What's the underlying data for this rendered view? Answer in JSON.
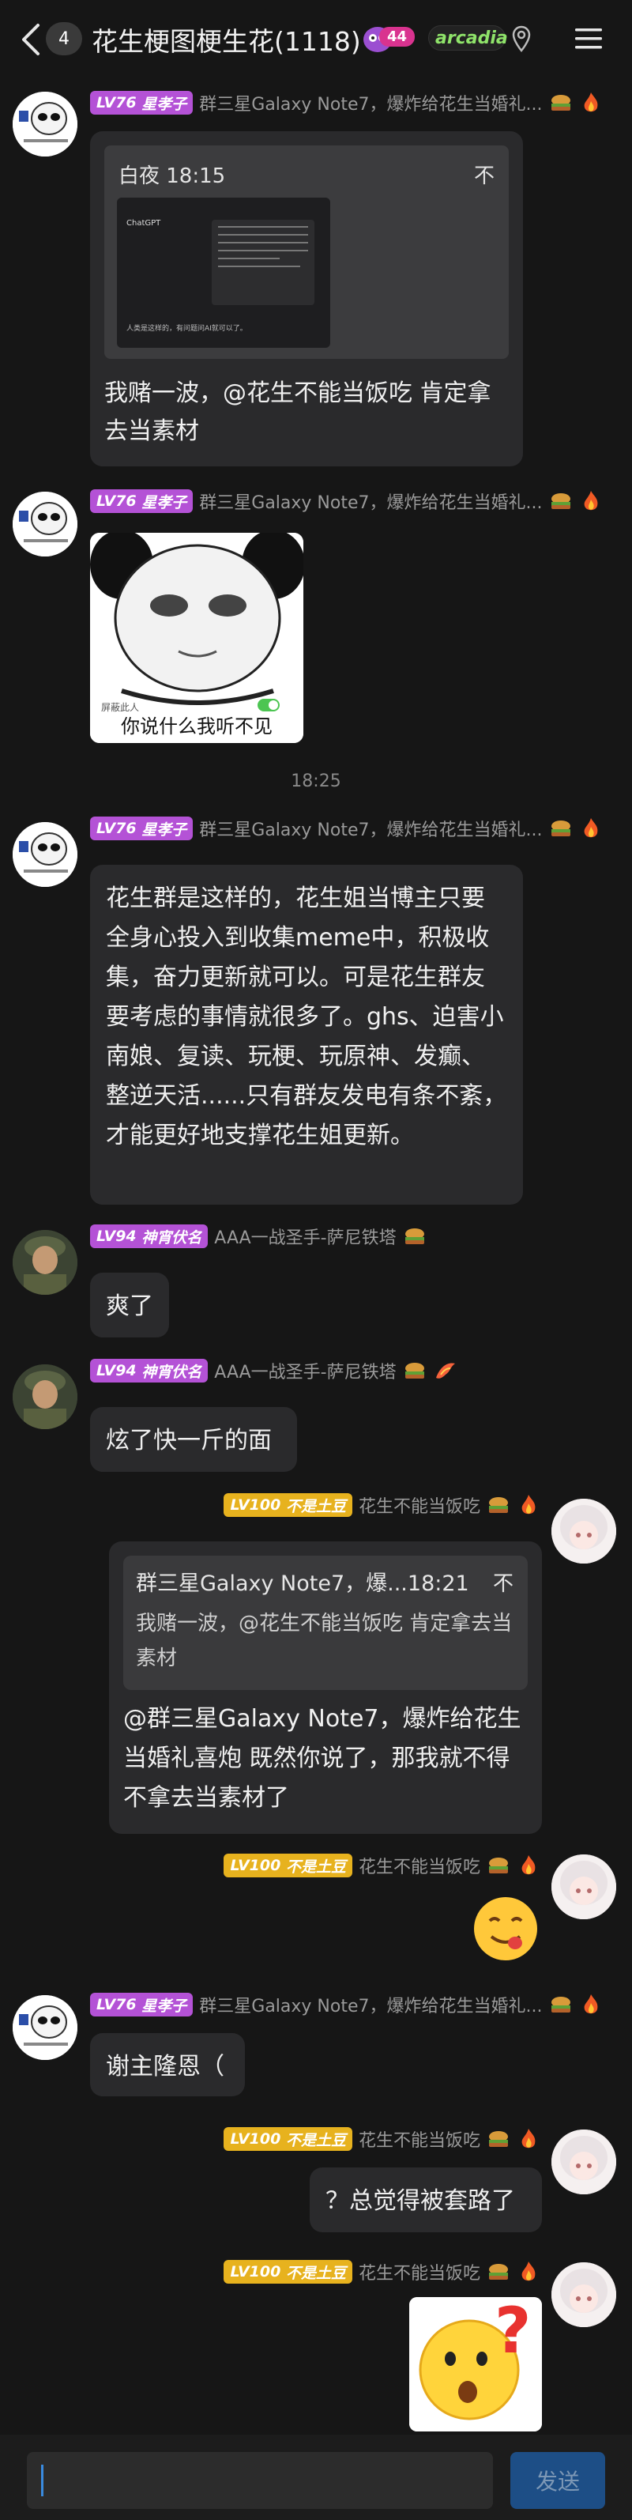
{
  "header": {
    "unread_count": "4",
    "title": "花生梗图梗生花(1118)",
    "owl_badge": "44",
    "arcadia_label": "arcadia"
  },
  "messages": [
    {
      "level": "LV76",
      "title": "星孝子",
      "nick": "群三星Galaxy Note7，爆炸给花生当婚礼...",
      "screenshot": {
        "header_left": "白夜 18:15",
        "header_right": "不",
        "app_name": "ChatGPT",
        "footer": "人类是这样的，有问题问AI就可以了。"
      },
      "text": "我赌一波，@花生不能当饭吃 肯定拿去当素材"
    },
    {
      "level": "LV76",
      "title": "星孝子",
      "nick": "群三星Galaxy Note7，爆炸给花生当婚礼...",
      "sticker_toggle": "屏蔽此人",
      "sticker_caption": "你说什么我听不见"
    },
    {
      "level": "LV76",
      "title": "星孝子",
      "nick": "群三星Galaxy Note7，爆炸给花生当婚礼...",
      "text": "花生群是这样的，花生姐当博主只要全身心投入到收集meme中，积极收集，奋力更新就可以。可是花生群友要考虑的事情就很多了。ghs、迫害小南娘、复读、玩梗、玩原神、发癫、整逆天活......只有群友发电有条不紊，才能更好地支撑花生姐更新。"
    },
    {
      "level": "LV94",
      "title": "神宵伏名",
      "nick": "AAA一战圣手-萨尼铁塔",
      "text": "爽了"
    },
    {
      "level": "LV94",
      "title": "神宵伏名",
      "nick": "AAA一战圣手-萨尼铁塔",
      "text": "炫了快一斤的面"
    },
    {
      "level": "LV100",
      "title": "不是土豆",
      "nick": "花生不能当饭吃",
      "quote_head": "群三星Galaxy Note7，爆...18:21",
      "quote_close": "不",
      "quote_text": "我赌一波，@花生不能当饭吃 肯定拿去当素材",
      "text": "@群三星Galaxy Note7，爆炸给花生当婚礼喜炮 既然你说了，那我就不得不拿去当素材了"
    },
    {
      "level": "LV100",
      "title": "不是土豆",
      "nick": "花生不能当饭吃"
    },
    {
      "level": "LV76",
      "title": "星孝子",
      "nick": "群三星Galaxy Note7，爆炸给花生当婚礼...",
      "text": "谢主隆恩（"
    },
    {
      "level": "LV100",
      "title": "不是土豆",
      "nick": "花生不能当饭吃",
      "text": "？总觉得被套路了"
    },
    {
      "level": "LV100",
      "title": "不是土豆",
      "nick": "花生不能当饭吃"
    }
  ],
  "time_separator": "18:25",
  "input": {
    "send_label": "发送"
  },
  "colors": {
    "background": "#161616",
    "bubble": "#2a2a2c",
    "level_purple": "#b452d6",
    "level_yellow": "#e7b21e",
    "send_button": "#1d4e86"
  }
}
